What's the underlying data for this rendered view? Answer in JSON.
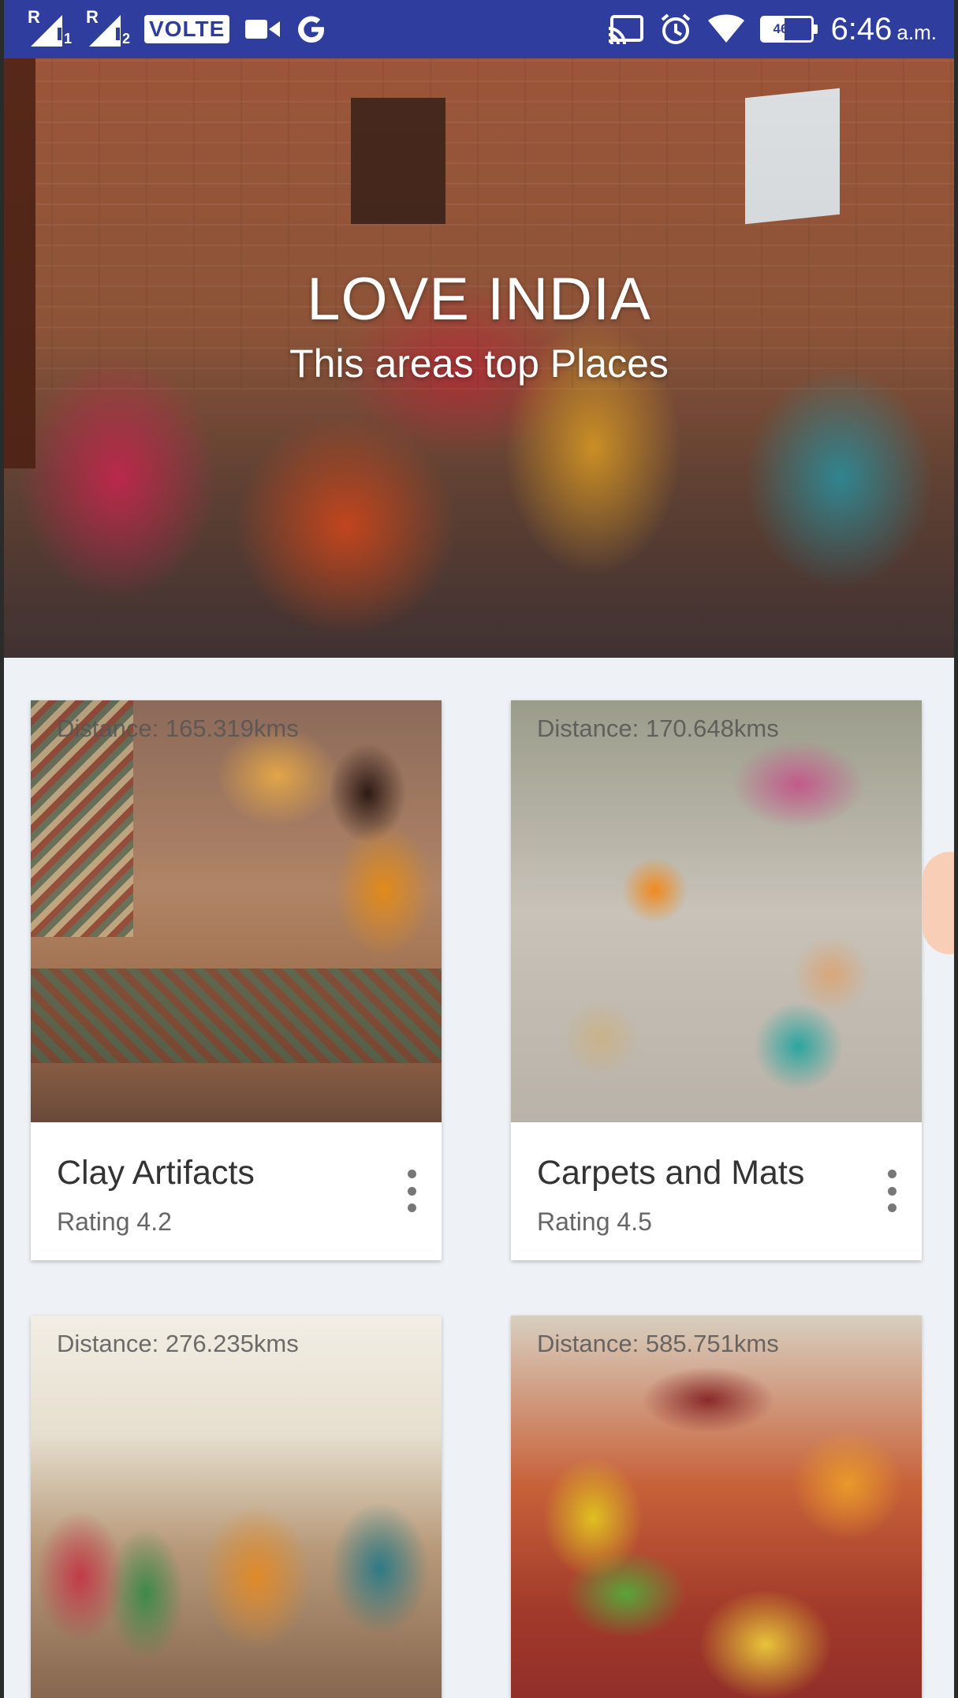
{
  "status_bar": {
    "sim1_label": "R",
    "sim1_sub": "1",
    "sim2_label": "R",
    "sim2_sub": "2",
    "volte": "VOLTE",
    "battery_percent": "46%",
    "battery_level": 0.46,
    "time": "6:46",
    "ampm": "a.m.",
    "icons": [
      "signal-icon",
      "signal-icon",
      "video-camera-icon",
      "google-icon",
      "cast-icon",
      "alarm-icon",
      "wifi-icon",
      "battery-icon"
    ]
  },
  "hero": {
    "title": "LOVE INDIA",
    "subtitle": "This areas top Places"
  },
  "cards": [
    {
      "distance": "Distance: 165.319kms",
      "title": "Clay Artifacts",
      "rating": "Rating 4.2"
    },
    {
      "distance": "Distance: 170.648kms",
      "title": "Carpets and Mats",
      "rating": "Rating 4.5"
    },
    {
      "distance": "Distance: 276.235kms",
      "title": "",
      "rating": ""
    },
    {
      "distance": "Distance: 585.751kms",
      "title": "",
      "rating": ""
    }
  ],
  "colors": {
    "status_bar": "#2f3e9e",
    "page_background": "#eef1f5",
    "card_background": "#ffffff"
  }
}
